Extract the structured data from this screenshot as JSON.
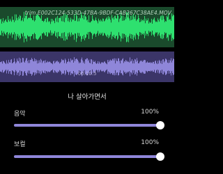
{
  "track": {
    "filename": "trim.E002C124-533D-47BA-9BDF-CAB267C38AE4.MOV",
    "time": "00:10.5"
  },
  "song_title": "나 살아가면서",
  "sliders": [
    {
      "label": "음악",
      "value_text": "100%",
      "value": 1.0
    },
    {
      "label": "보컬",
      "value_text": "100%",
      "value": 1.0
    }
  ],
  "colors": {
    "green_track_bg": "#1a4a2c",
    "green_wave": "#2ee06f",
    "purple_track_bg": "#3b3568",
    "purple_wave": "#8f86d9",
    "slider_fill": "#8f86d9"
  }
}
